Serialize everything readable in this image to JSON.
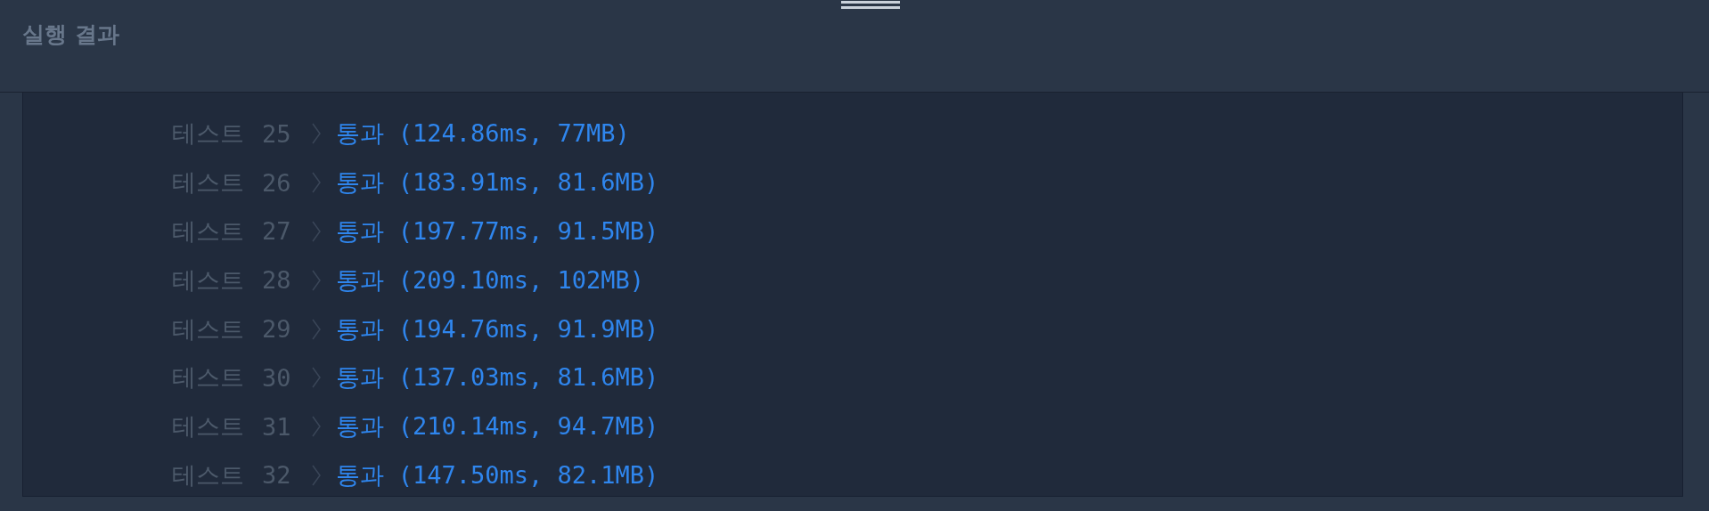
{
  "header": {
    "title": "실행 결과"
  },
  "results": [
    {
      "label": "테스트",
      "number": "25",
      "result": "통과 (124.86ms, 77MB)"
    },
    {
      "label": "테스트",
      "number": "26",
      "result": "통과 (183.91ms, 81.6MB)"
    },
    {
      "label": "테스트",
      "number": "27",
      "result": "통과 (197.77ms, 91.5MB)"
    },
    {
      "label": "테스트",
      "number": "28",
      "result": "통과 (209.10ms, 102MB)"
    },
    {
      "label": "테스트",
      "number": "29",
      "result": "통과 (194.76ms, 91.9MB)"
    },
    {
      "label": "테스트",
      "number": "30",
      "result": "통과 (137.03ms, 81.6MB)"
    },
    {
      "label": "테스트",
      "number": "31",
      "result": "통과 (210.14ms, 94.7MB)"
    },
    {
      "label": "테스트",
      "number": "32",
      "result": "통과 (147.50ms, 82.1MB)"
    }
  ]
}
